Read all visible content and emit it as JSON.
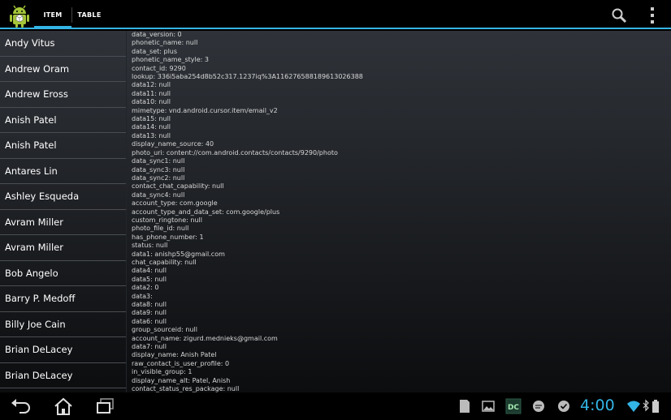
{
  "tabs": [
    {
      "label": "ITEM"
    },
    {
      "label": "TABLE"
    }
  ],
  "contacts": [
    "Andy Vitus",
    "Andrew Oram",
    "Andrew Eross",
    "Anish Patel",
    "Anish Patel",
    "Antares Lin",
    "Ashley Esqueda",
    "Avram Miller",
    "Avram Miller",
    "Bob Angelo",
    "Barry P. Medoff",
    "Billy Joe Cain",
    "Brian DeLacey",
    "Brian DeLacey"
  ],
  "details": [
    "data_version: 0",
    "phonetic_name: null",
    "data_set: plus",
    "phonetic_name_style: 3",
    "contact_id: 9290",
    "lookup: 336i5aba254d8b52c317.1237iq%3A116276588189613026388",
    "data12: null",
    "data11: null",
    "data10: null",
    "mimetype: vnd.android.cursor.item/email_v2",
    "data15: null",
    "data14: null",
    "data13: null",
    "display_name_source: 40",
    "photo_uri: content://com.android.contacts/contacts/9290/photo",
    "data_sync1: null",
    "data_sync3: null",
    "data_sync2: null",
    "contact_chat_capability: null",
    "data_sync4: null",
    "account_type: com.google",
    "account_type_and_data_set: com.google/plus",
    "custom_ringtone: null",
    "photo_file_id: null",
    "has_phone_number: 1",
    "status: null",
    "data1: anishp55@gmail.com",
    "chat_capability: null",
    "data4: null",
    "data5: null",
    "data2: 0",
    "data3:",
    "data8: null",
    "data9: null",
    "data6: null",
    "group_sourceid: null",
    "account_name: zigurd.mednieks@gmail.com",
    "data7: null",
    "display_name: Anish Patel",
    "raw_contact_is_user_profile: 0",
    "in_visible_group: 1",
    "display_name_alt: Patel, Anish",
    "contact_status_res_package: null"
  ],
  "clock": "4:00",
  "accent_color": "#33b5e5"
}
